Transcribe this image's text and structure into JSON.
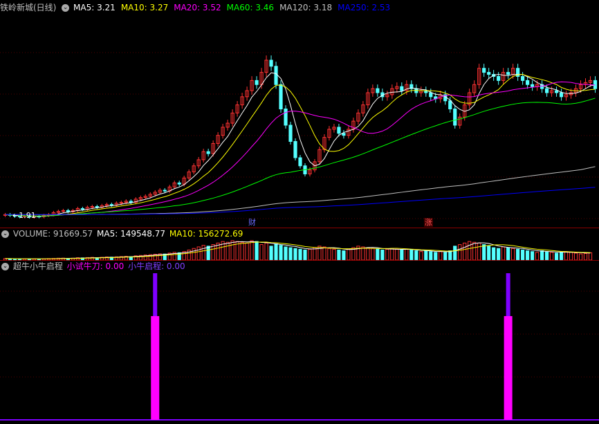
{
  "header": {
    "stock": "铁岭新城(日线)",
    "ma": [
      {
        "label": "MA5: 3.21",
        "color": "#ffffff"
      },
      {
        "label": "MA10: 3.27",
        "color": "#ffff00"
      },
      {
        "label": "MA20: 3.52",
        "color": "#ff00ff"
      },
      {
        "label": "MA60: 3.46",
        "color": "#00ff00"
      },
      {
        "label": "MA120: 3.18",
        "color": "#c0c0c0"
      },
      {
        "label": "MA250: 2.53",
        "color": "#0000ff"
      }
    ]
  },
  "price_panel": {
    "low_label": "←1.91",
    "markers": [
      {
        "text": "财",
        "color": "#5555ff"
      },
      {
        "text": "涨",
        "color": "#ff5555"
      }
    ]
  },
  "volume_header": {
    "volume": "VOLUME: 91669.57",
    "ma5": "MA5: 149548.77",
    "ma10": "MA10: 156272.69"
  },
  "indicator_header": {
    "name": "超牛小牛启程",
    "s1": "小试牛刀: 0.00",
    "s2": "小牛启程: 0.00"
  },
  "colors": {
    "up": "#ff3232",
    "down": "#54ffff",
    "ma5": "#ffffff",
    "ma10": "#ffff00",
    "ma20": "#ff00ff",
    "ma60": "#00ff00",
    "ma120": "#c0c0c0",
    "ma250": "#0000ff",
    "sig1": "#ff00ff",
    "sig2": "#7f00ff"
  },
  "chart_data": {
    "type": "candlestick",
    "price_range": [
      1.8,
      6.6
    ],
    "closes": [
      2.0,
      1.98,
      1.96,
      1.95,
      1.97,
      1.94,
      1.96,
      1.95,
      1.98,
      2.0,
      2.05,
      2.08,
      2.1,
      2.07,
      2.1,
      2.15,
      2.13,
      2.18,
      2.2,
      2.18,
      2.22,
      2.25,
      2.23,
      2.28,
      2.3,
      2.33,
      2.3,
      2.38,
      2.42,
      2.45,
      2.5,
      2.55,
      2.6,
      2.58,
      2.68,
      2.78,
      2.75,
      2.9,
      3.05,
      3.2,
      3.35,
      3.55,
      3.5,
      3.75,
      3.95,
      4.15,
      4.25,
      4.5,
      4.7,
      4.9,
      5.05,
      5.3,
      5.2,
      5.5,
      5.8,
      5.65,
      5.2,
      4.6,
      4.2,
      3.8,
      3.4,
      3.2,
      3.0,
      3.1,
      3.3,
      3.6,
      3.9,
      4.1,
      4.15,
      4.0,
      3.95,
      4.1,
      4.3,
      4.5,
      4.7,
      5.0,
      5.1,
      5.0,
      4.9,
      4.95,
      5.1,
      5.15,
      5.05,
      5.2,
      5.1,
      5.0,
      5.05,
      5.0,
      4.9,
      4.85,
      4.95,
      4.8,
      4.6,
      4.2,
      4.4,
      4.7,
      5.0,
      5.2,
      5.6,
      5.5,
      5.45,
      5.4,
      5.3,
      5.5,
      5.45,
      5.6,
      5.4,
      5.3,
      5.2,
      5.15,
      5.2,
      5.1,
      5.0,
      5.05,
      5.0,
      4.9,
      4.95,
      5.0,
      5.1,
      5.2,
      5.25,
      5.3,
      5.1
    ],
    "volumes": [
      20,
      18,
      15,
      14,
      16,
      15,
      17,
      14,
      18,
      20,
      22,
      24,
      25,
      22,
      24,
      30,
      28,
      32,
      35,
      30,
      36,
      40,
      38,
      42,
      45,
      48,
      44,
      55,
      60,
      65,
      70,
      75,
      80,
      78,
      90,
      100,
      95,
      110,
      130,
      150,
      170,
      190,
      180,
      200,
      220,
      240,
      230,
      250,
      240,
      230,
      220,
      250,
      240,
      200,
      220,
      180,
      210,
      190,
      170,
      160,
      150,
      140,
      130,
      140,
      160,
      180,
      170,
      150,
      140,
      130,
      120,
      140,
      160,
      180,
      170,
      160,
      150,
      140,
      130,
      140,
      150,
      140,
      130,
      140,
      130,
      120,
      110,
      120,
      110,
      100,
      110,
      100,
      120,
      180,
      200,
      220,
      240,
      230,
      220,
      200,
      180,
      160,
      150,
      170,
      160,
      150,
      140,
      130,
      120,
      110,
      100,
      120,
      110,
      100,
      90,
      100,
      110,
      100,
      90,
      80,
      85,
      95
    ],
    "indicator": {
      "series": [
        {
          "name": "小试牛刀",
          "values": [
            0,
            1
          ]
        },
        {
          "name": "小牛启程",
          "values": [
            0,
            1
          ]
        }
      ],
      "signal_index": [
        31,
        104
      ]
    }
  }
}
